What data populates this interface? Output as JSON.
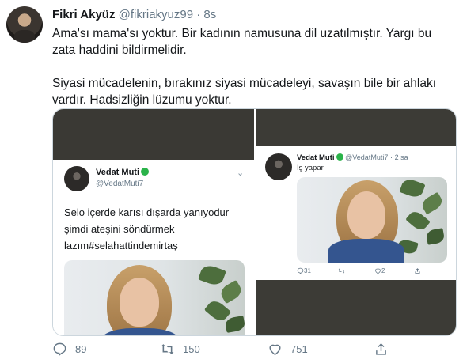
{
  "tweet": {
    "author_name": "Fikri Akyüz",
    "handle": "@fikriakyuz99",
    "separator": "·",
    "time": "8s",
    "text_p1": "Ama'sı mama'sı yoktur. Bir kadının namusuna dil uzatılmıştır. Yargı bu zata haddini bildirmelidir.",
    "text_p2": "Siyasi mücadelenin, bırakınız siyasi mücadeleyi, savaşın bile bir ahlakı vardır. Hadsizliğin lüzumu yoktur."
  },
  "left_screenshot": {
    "author_name": "Vedat Muti",
    "handle": "@VedatMuti7",
    "text": "Selo içerde karısı dışarda yanıyodur şimdi ateşini söndürmek lazım#selahattindemirtaş"
  },
  "right_screenshot": {
    "author_name": "Vedat Muti",
    "handle": "@VedatMuti7",
    "separator": "·",
    "time": "2 sa",
    "text": "İş yapar",
    "reply_count": "31",
    "retweet_count": "",
    "like_count": "2"
  },
  "actions": {
    "reply_count": "89",
    "retweet_count": "150",
    "like_count": "751"
  },
  "colors": {
    "secondary_text": "#657786",
    "verified_green": "#2bb34a",
    "dark_band": "#3a3934"
  },
  "icons": [
    "reply-icon",
    "retweet-icon",
    "like-icon",
    "share-icon",
    "chevron-down-icon",
    "green-circle-icon"
  ]
}
